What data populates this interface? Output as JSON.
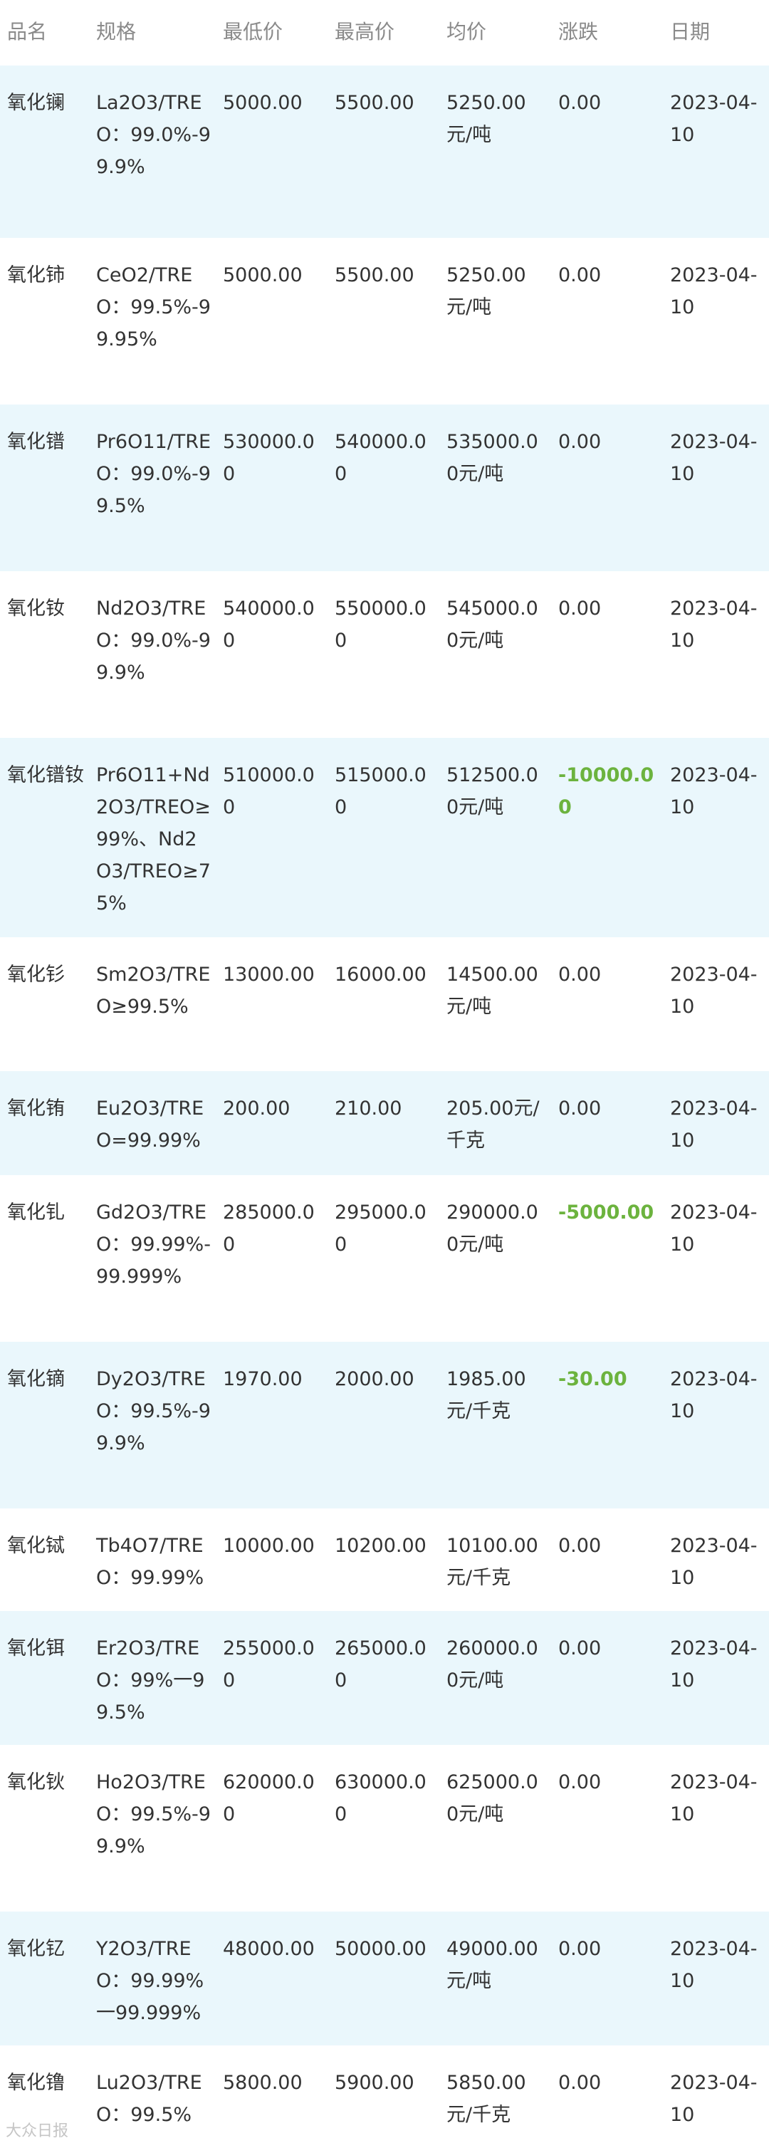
{
  "table": {
    "headers": [
      "品名",
      "规格",
      "最低价",
      "最高价",
      "均价",
      "涨跌",
      "日期"
    ],
    "rows": [
      {
        "name": "氧化镧",
        "spec": "La2O3/TREO：99.0%-99.9%",
        "low": "5000.00",
        "high": "5500.00",
        "avg": "5250.00元/吨",
        "change": "0.00",
        "date": "2023-04-10"
      },
      {
        "name": "氧化铈",
        "spec": "CeO2/TREO：99.5%-99.95%",
        "low": "5000.00",
        "high": "5500.00",
        "avg": "5250.00元/吨",
        "change": "0.00",
        "date": "2023-04-10"
      },
      {
        "name": "氧化镨",
        "spec": "Pr6O11/TREO：99.0%-99.5%",
        "low": "530000.00",
        "high": "540000.00",
        "avg": "535000.00元/吨",
        "change": "0.00",
        "date": "2023-04-10"
      },
      {
        "name": "氧化钕",
        "spec": "Nd2O3/TREO：99.0%-99.9%",
        "low": "540000.00",
        "high": "550000.00",
        "avg": "545000.00元/吨",
        "change": "0.00",
        "date": "2023-04-10"
      },
      {
        "name": "氧化镨钕",
        "spec": "Pr6O11+Nd2O3/TREO≥99%、Nd2O3/TREO≥75%",
        "low": "510000.00",
        "high": "515000.00",
        "avg": "512500.00元/吨",
        "change": "-10000.00",
        "date": "2023-04-10"
      },
      {
        "name": "氧化钐",
        "spec": "Sm2O3/TREO≥99.5%",
        "low": "13000.00",
        "high": "16000.00",
        "avg": "14500.00元/吨",
        "change": "0.00",
        "date": "2023-04-10"
      },
      {
        "name": "氧化铕",
        "spec": "Eu2O3/TREO=99.99%",
        "low": "200.00",
        "high": "210.00",
        "avg": "205.00元/千克",
        "change": "0.00",
        "date": "2023-04-10"
      },
      {
        "name": "氧化钆",
        "spec": "Gd2O3/TREO：99.99%-99.999%",
        "low": "285000.00",
        "high": "295000.00",
        "avg": "290000.00元/吨",
        "change": "-5000.00",
        "date": "2023-04-10"
      },
      {
        "name": "氧化镝",
        "spec": "Dy2O3/TREO：99.5%-99.9%",
        "low": "1970.00",
        "high": "2000.00",
        "avg": "1985.00元/千克",
        "change": "-30.00",
        "date": "2023-04-10"
      },
      {
        "name": "氧化铽",
        "spec": "Tb4O7/TREO：99.99%",
        "low": "10000.00",
        "high": "10200.00",
        "avg": "10100.00元/千克",
        "change": "0.00",
        "date": "2023-04-10"
      },
      {
        "name": "氧化铒",
        "spec": "Er2O3/TREO：99%一99.5%",
        "low": "255000.00",
        "high": "265000.00",
        "avg": "260000.00元/吨",
        "change": "0.00",
        "date": "2023-04-10"
      },
      {
        "name": "氧化钬",
        "spec": "Ho2O3/TREO：99.5%-99.9%",
        "low": "620000.00",
        "high": "630000.00",
        "avg": "625000.00元/吨",
        "change": "0.00",
        "date": "2023-04-10"
      },
      {
        "name": "氧化钇",
        "spec": "Y2O3/TREO：99.99%一99.999%",
        "low": "48000.00",
        "high": "50000.00",
        "avg": "49000.00元/吨",
        "change": "0.00",
        "date": "2023-04-10"
      },
      {
        "name": "氧化镥",
        "spec": "Lu2O3/TREO：99.5%",
        "low": "5800.00",
        "high": "5900.00",
        "avg": "5850.00元/千克",
        "change": "0.00",
        "date": "2023-04-10"
      }
    ]
  },
  "colors": {
    "header_text": "#8a8a8a",
    "body_text": "#333333",
    "row_alt_bg": "#eaf7fc",
    "row_plain_bg": "#ffffff",
    "negative_change": "#6cb33e"
  },
  "watermark": "大众日报"
}
